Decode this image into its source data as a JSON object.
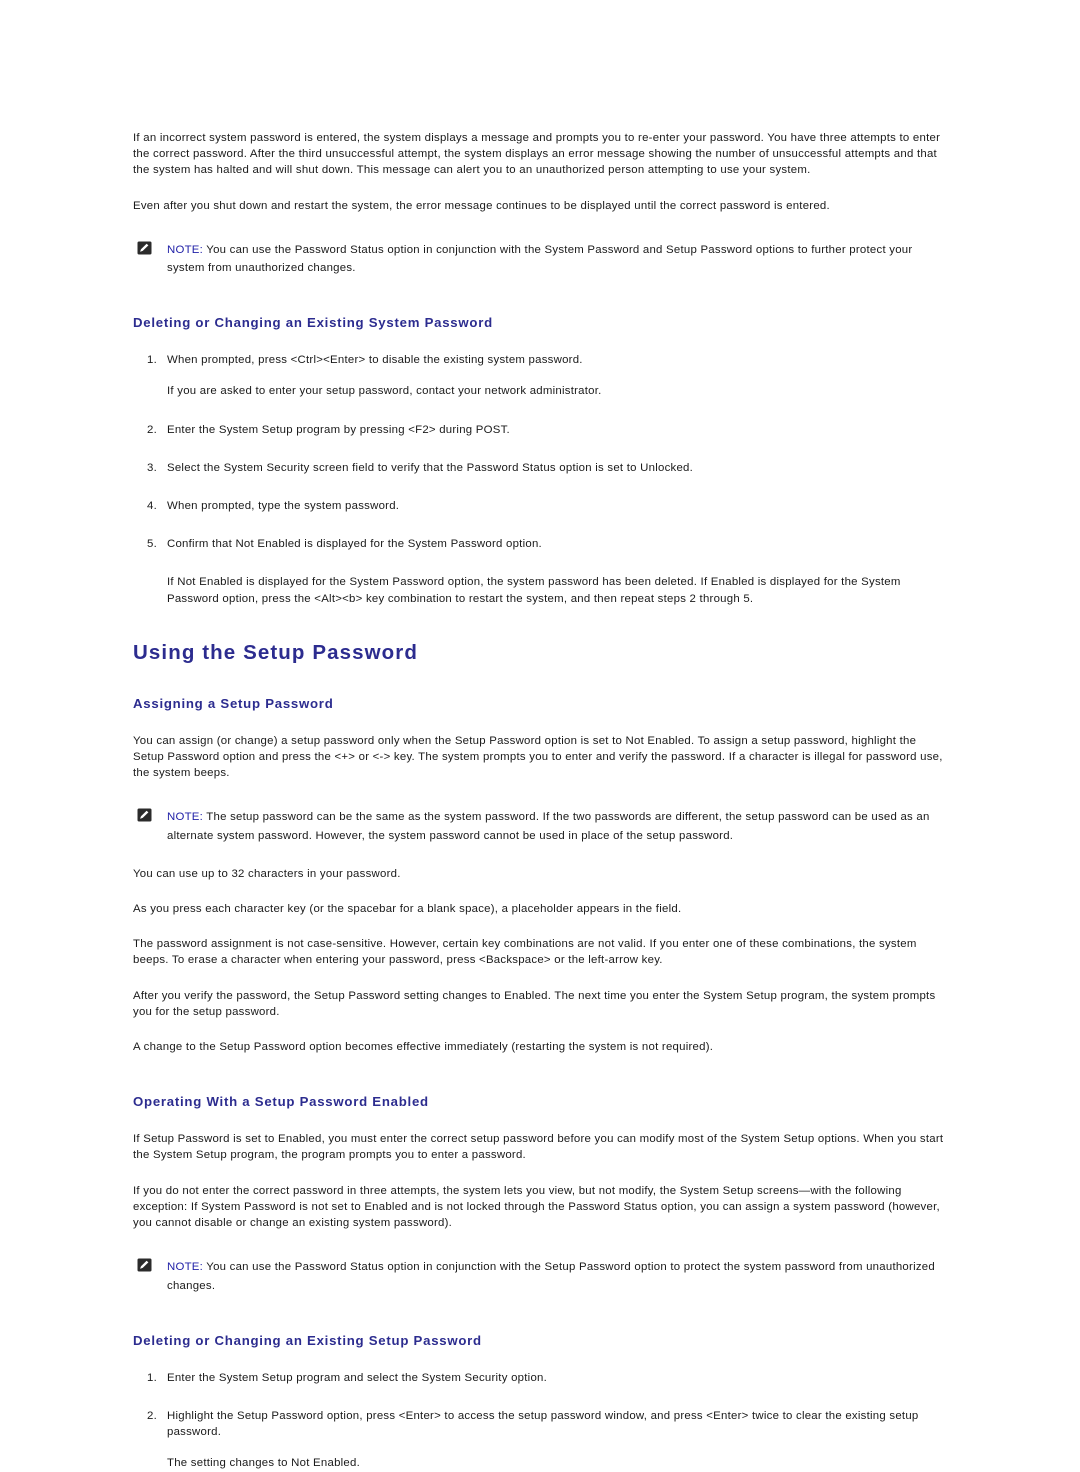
{
  "document": {
    "intro_paragraphs": [
      "If an incorrect system password is entered, the system displays a message and prompts you to re-enter your password. You have three attempts to enter the correct password. After the third unsuccessful attempt, the system displays an error message showing the number of unsuccessful attempts and that the system has halted and will shut down. This message can alert you to an unauthorized person attempting to use your system.",
      "Even after you shut down and restart the system, the error message continues to be displayed until the correct password is entered."
    ],
    "notes": {
      "label": "NOTE:",
      "note1_text": " You can use the Password Status option in conjunction with the System Password and Setup Password options to further protect your system from unauthorized changes.",
      "note2_text": " The setup password can be the same as the system password. If the two passwords are different, the setup password can be used as an alternate system password. However, the system password cannot be used in place of the setup password.",
      "note3_text": " You can use the Password Status option in conjunction with the Setup Password option to protect the system password from unauthorized changes."
    },
    "section_delete_system_password": {
      "heading": "Deleting or Changing an Existing System Password",
      "steps": [
        "When prompted, press <Ctrl><Enter> to disable the existing system password.",
        "Enter the System Setup program by pressing <F2> during POST.",
        "Select the System Security screen field to verify that the Password Status option is set to Unlocked.",
        "When prompted, type the system password.",
        "Confirm that Not Enabled is displayed for the System Password option."
      ],
      "step1_subpara": "If you are asked to enter your setup password, contact your network administrator.",
      "closing_paragraph": "If Not Enabled is displayed for the System Password option, the system password has been deleted. If Enabled is displayed for the System Password option, press the <Alt><b> key combination to restart the system, and then repeat steps 2 through 5."
    },
    "section_using_setup_password": {
      "heading": "Using the Setup Password"
    },
    "section_assigning": {
      "heading": "Assigning a Setup Password",
      "paragraph1": "You can assign (or change) a setup password only when the Setup Password option is set to Not Enabled. To assign a setup password, highlight the Setup Password option and press the <+> or <-> key. The system prompts you to enter and verify the password. If a character is illegal for password use, the system beeps.",
      "paragraph2": "You can use up to 32 characters in your password.",
      "paragraph3": "As you press each character key (or the spacebar for a blank space), a placeholder appears in the field.",
      "paragraph4": "The password assignment is not case-sensitive. However, certain key combinations are not valid. If you enter one of these combinations, the system beeps. To erase a character when entering your password, press <Backspace> or the left-arrow key.",
      "paragraph5": "After you verify the password, the Setup Password setting changes to Enabled. The next time you enter the System Setup program, the system prompts you for the setup password.",
      "paragraph6": "A change to the Setup Password option becomes effective immediately (restarting the system is not required)."
    },
    "section_operating": {
      "heading": "Operating With a Setup Password Enabled",
      "paragraph1": "If Setup Password is set to Enabled, you must enter the correct setup password before you can modify most of the System Setup options. When you start the System Setup program, the program prompts you to enter a password.",
      "paragraph2": "If you do not enter the correct password in three attempts, the system lets you view, but not modify, the System Setup screens—with the following exception: If System Password is not set to Enabled and is not locked through the Password Status option, you can assign a system password (however, you cannot disable or change an existing system password)."
    },
    "section_delete_setup_password": {
      "heading": "Deleting or Changing an Existing Setup Password",
      "steps": [
        "Enter the System Setup program and select the System Security option.",
        "Highlight the Setup Password option, press <Enter> to access the setup password window, and press <Enter> twice to clear the existing setup password."
      ],
      "closing_paragraph": "The setting changes to Not Enabled."
    },
    "colors": {
      "heading_navy": "#2c2c8f",
      "note_label_blue": "#2222a8",
      "body_text": "#1a1a1a",
      "page_background": "#ffffff"
    }
  }
}
